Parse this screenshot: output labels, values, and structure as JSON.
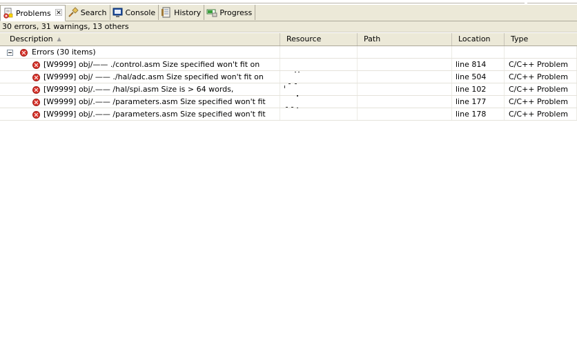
{
  "tabs": [
    {
      "label": "Problems",
      "icon": "problems-icon",
      "active": true,
      "closable": true
    },
    {
      "label": "Search",
      "icon": "search-icon",
      "active": false
    },
    {
      "label": "Console",
      "icon": "console-icon",
      "active": false
    },
    {
      "label": "History",
      "icon": "history-icon",
      "active": false
    },
    {
      "label": "Progress",
      "icon": "progress-icon",
      "active": false
    }
  ],
  "summary": "30 errors, 31 warnings, 13 others",
  "columns": {
    "description": "Description",
    "resource": "Resource",
    "path": "Path",
    "location": "Location",
    "type": "Type"
  },
  "group": {
    "label": "Errors (30 items)"
  },
  "rows": [
    {
      "description": "[W9999] obj/—— ./control.asm Size specified won't fit on",
      "location": "line 814",
      "type": "C/C++ Problem"
    },
    {
      "description": "[W9999] obj/ —— ./hal/adc.asm Size specified won't fit on",
      "location": "line 504",
      "type": "C/C++ Problem"
    },
    {
      "description": "[W9999] obj/.—— /hal/spi.asm Size is > 64 words,",
      "location": "line 102",
      "type": "C/C++ Problem"
    },
    {
      "description": "[W9999] obj/.—— /parameters.asm Size specified won't fit",
      "location": "line 177",
      "type": "C/C++ Problem"
    },
    {
      "description": "[W9999] obj/.—— /parameters.asm Size specified won't fit",
      "location": "line 178",
      "type": "C/C++ Problem"
    }
  ],
  "colors": {
    "error": "#d9332b",
    "chrome": "#ece9d8",
    "border": "#aca899"
  }
}
